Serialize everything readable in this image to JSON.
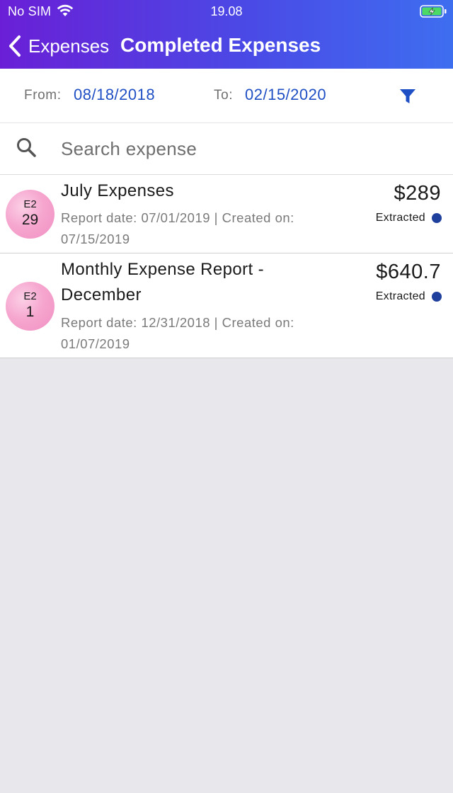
{
  "status_bar": {
    "carrier": "No SIM",
    "time": "19.08"
  },
  "nav": {
    "back_label": "Expenses",
    "title": "Completed Expenses"
  },
  "filter": {
    "from_label": "From:",
    "from_date": "08/18/2018",
    "to_label": "To:",
    "to_date": "02/15/2020",
    "icon": "filter-icon"
  },
  "search": {
    "placeholder": "Search expense",
    "value": "",
    "icon": "search-icon"
  },
  "expenses": [
    {
      "avatar_code": "E2",
      "avatar_day": "29",
      "title": "July Expenses",
      "meta": "Report date: 07/01/2019 | Created on: 07/15/2019",
      "amount": "$289",
      "status": "Extracted"
    },
    {
      "avatar_code": "E2",
      "avatar_day": "1",
      "title": "Monthly Expense Report - December",
      "meta": "Report date: 12/31/2018 | Created on: 01/07/2019",
      "amount": "$640.7",
      "status": "Extracted"
    }
  ],
  "colors": {
    "header_gradient_start": "#6a1fd6",
    "header_gradient_end": "#3e6ef0",
    "accent_blue": "#1f4fc4",
    "status_dot": "#1e3f9c",
    "avatar_pink": "#f6a7cf",
    "battery_green": "#4cd964"
  }
}
